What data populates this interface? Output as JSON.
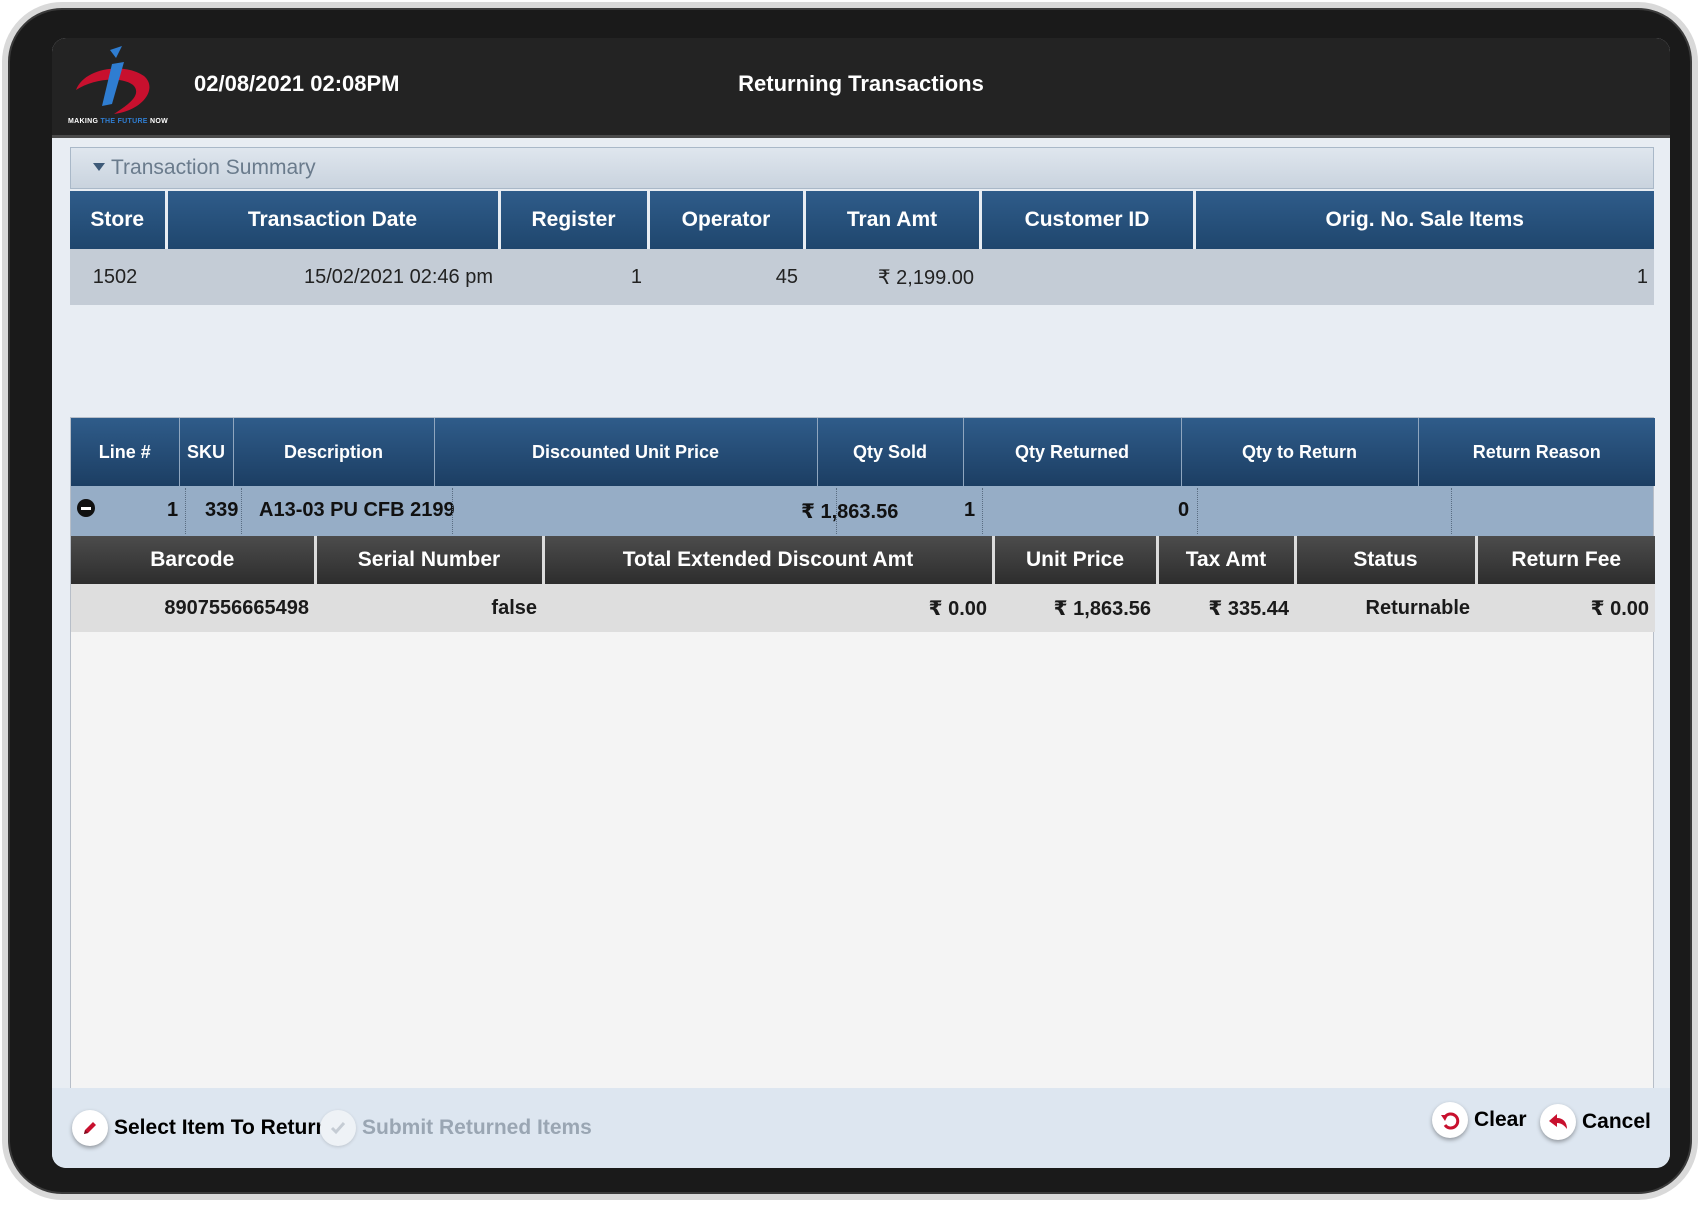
{
  "header": {
    "datetime": "02/08/2021 02:08PM",
    "title": "Returning Transactions",
    "logo_tagline_a": "MAKING ",
    "logo_tagline_b": "THE FUTURE",
    "logo_tagline_c": " NOW"
  },
  "summary": {
    "section_label": "Transaction Summary",
    "columns": [
      "Store",
      "Transaction Date",
      "Register",
      "Operator",
      "Tran Amt",
      "Customer ID",
      "Orig. No. Sale Items"
    ],
    "row": {
      "store": "1502",
      "transaction_date": "15/02/2021 02:46 pm",
      "register": "1",
      "operator": "45",
      "tran_amt": "₹ 2,199.00",
      "customer_id": "",
      "orig_no_sale_items": "1"
    }
  },
  "lines": {
    "columns": [
      "Line #",
      "SKU",
      "Description",
      "Discounted Unit Price",
      "Qty Sold",
      "Qty Returned",
      "Qty to Return",
      "Return Reason"
    ],
    "item": {
      "line": "1",
      "sku": "339",
      "description": "A13-03 PU CFB 2199",
      "discounted_unit_price": "₹ 1,863.56",
      "qty_sold": "1",
      "qty_returned": "0",
      "qty_to_return": "",
      "return_reason": ""
    },
    "detail_columns": [
      "Barcode",
      "Serial Number",
      "Total Extended Discount Amt",
      "Unit Price",
      "Tax Amt",
      "Status",
      "Return Fee"
    ],
    "detail": {
      "barcode": "8907556665498",
      "serial_number": "false",
      "total_extended_discount_amt": "₹ 0.00",
      "unit_price": "₹ 1,863.56",
      "tax_amt": "₹ 335.44",
      "status": "Returnable",
      "return_fee": "₹ 0.00"
    }
  },
  "footer": {
    "select_item": "Select Item To Return",
    "submit": "Submit Returned Items",
    "clear": "Clear",
    "cancel": "Cancel"
  },
  "icons": {
    "pencil": "pencil-icon",
    "check": "check-icon",
    "undo": "undo-icon",
    "reply": "reply-icon",
    "minus": "minus-circle-icon",
    "caret": "caret-down-icon"
  },
  "colors": {
    "header_bg": "#232323",
    "table_header_blue": "#2f5c8a",
    "item_row": "#96adc6",
    "accent_red": "#c8102e",
    "logo_blue": "#2f7dd1"
  }
}
